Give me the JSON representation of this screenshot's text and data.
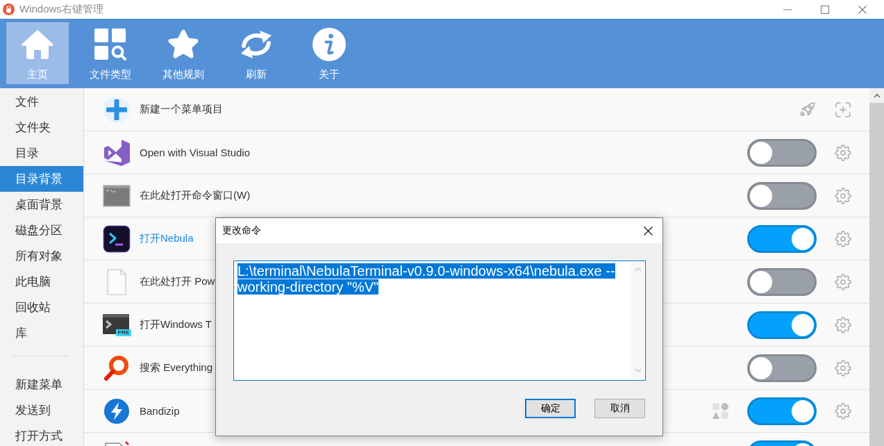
{
  "window": {
    "title": "Windows右键管理"
  },
  "toolbar": {
    "buttons": [
      {
        "label": "主页",
        "selected": true
      },
      {
        "label": "文件类型",
        "selected": false
      },
      {
        "label": "其他规则",
        "selected": false
      },
      {
        "label": "刷新",
        "selected": false
      },
      {
        "label": "关于",
        "selected": false
      }
    ]
  },
  "sidebar": {
    "sections": [
      {
        "items": [
          {
            "label": "文件",
            "selected": false
          },
          {
            "label": "文件夹",
            "selected": false
          },
          {
            "label": "目录",
            "selected": false
          },
          {
            "label": "目录背景",
            "selected": true
          },
          {
            "label": "桌面背景",
            "selected": false
          },
          {
            "label": "磁盘分区",
            "selected": false
          },
          {
            "label": "所有对象",
            "selected": false
          },
          {
            "label": "此电脑",
            "selected": false
          },
          {
            "label": "回收站",
            "selected": false
          },
          {
            "label": "库",
            "selected": false
          }
        ]
      },
      {
        "items": [
          {
            "label": "新建菜单",
            "selected": false
          },
          {
            "label": "发送到",
            "selected": false
          },
          {
            "label": "打开方式",
            "selected": false
          }
        ]
      }
    ]
  },
  "rows": [
    {
      "kind": "new_item",
      "label": "新建一个菜单项目",
      "selected": false
    },
    {
      "kind": "toggle",
      "label": "Open with Visual Studio",
      "on": false,
      "selected": false
    },
    {
      "kind": "toggle",
      "label": "在此处打开命令窗口(W)",
      "on": false,
      "selected": false
    },
    {
      "kind": "toggle",
      "label": "打开Nebula",
      "on": true,
      "selected": true
    },
    {
      "kind": "toggle",
      "label": "在此处打开 Pow",
      "on": false,
      "selected": false
    },
    {
      "kind": "toggle",
      "label": "打开Windows T",
      "on": true,
      "selected": false,
      "badge": "PRE"
    },
    {
      "kind": "toggle",
      "label": "搜索 Everything",
      "on": false,
      "selected": false
    },
    {
      "kind": "toggle",
      "label": "Bandizip",
      "on": true,
      "selected": false
    },
    {
      "kind": "toggle",
      "on": true
    }
  ],
  "dialog": {
    "title": "更改命令",
    "command": {
      "value": "L:\\terminal\\NebulaTerminal-v0.9.0-windows-x64\\nebula.exe --working-directory \"%V\"",
      "selected": true
    },
    "buttons": [
      {
        "label": "确定",
        "default": true
      },
      {
        "label": "取消",
        "default": false
      }
    ]
  }
}
